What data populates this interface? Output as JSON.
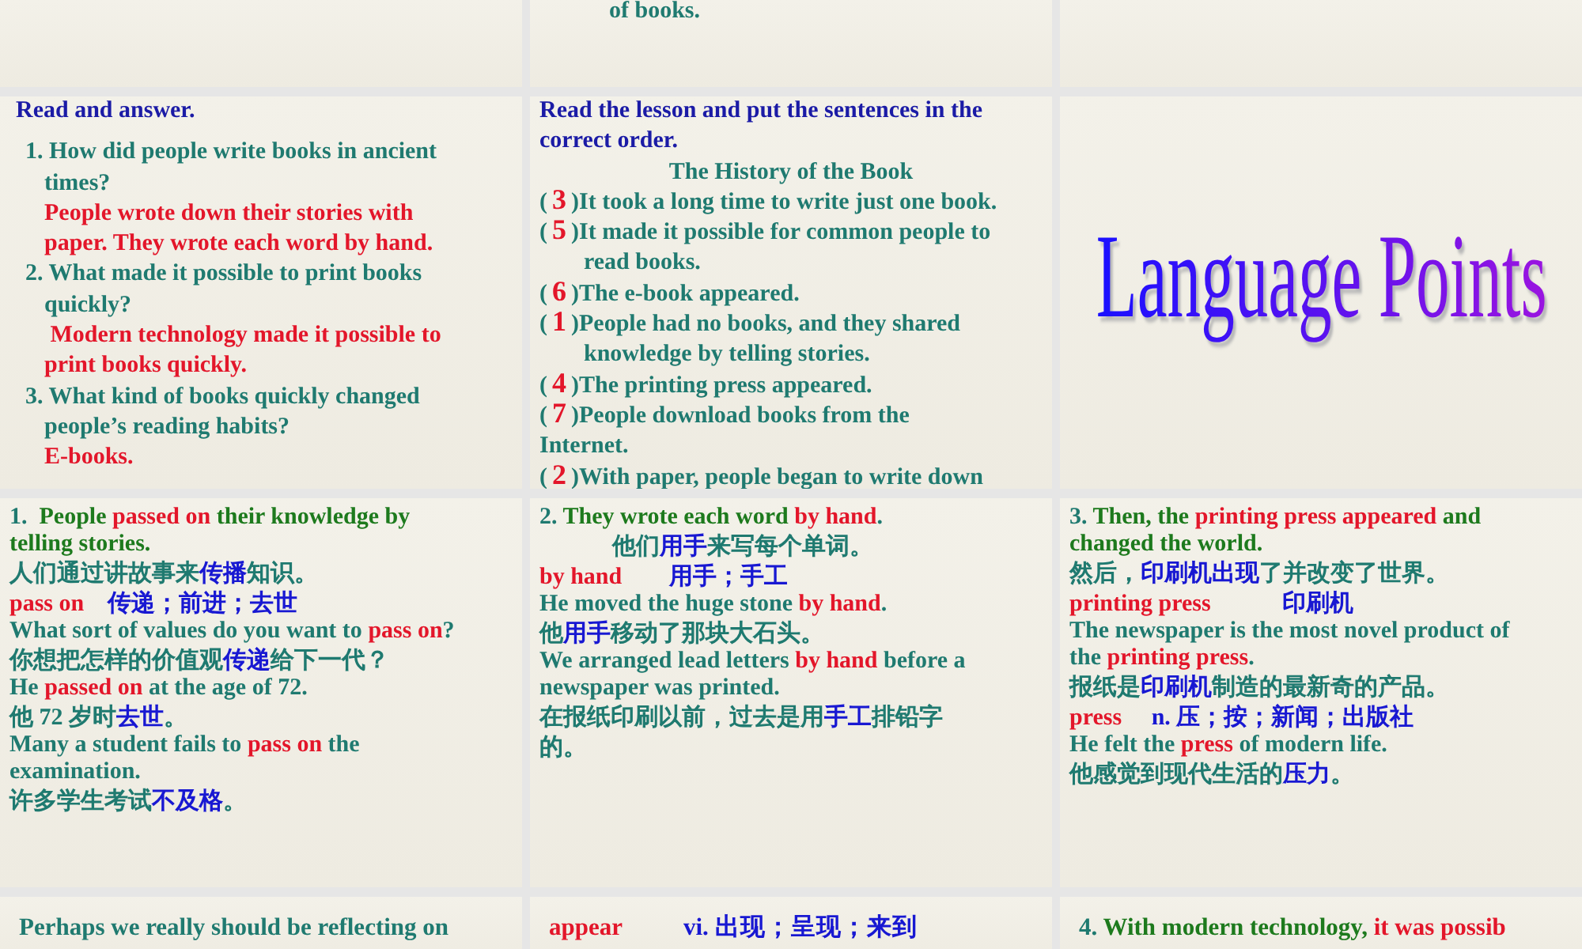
{
  "slides": [
    {
      "kind": "text"
    },
    {
      "kind": "text",
      "lines": [
        {
          "kind": "hang",
          "parts": [
            {
              "t": "of books.",
              "kind": "body"
            }
          ]
        }
      ]
    },
    {
      "kind": "text"
    },
    {
      "kind": "text",
      "lines": [
        {
          "kind": "head",
          "parts": [
            {
              "t": "Read and answer.",
              "kind": "heading"
            }
          ]
        },
        {
          "kind": "item",
          "parts": [
            {
              "t": "1. How did people write books in ancient",
              "kind": "body"
            }
          ]
        },
        {
          "kind": "cont",
          "parts": [
            {
              "t": "times?",
              "kind": "body"
            }
          ]
        },
        {
          "kind": "cont",
          "parts": [
            {
              "t": "People wrote down their stories with",
              "kind": "term"
            }
          ]
        },
        {
          "kind": "cont",
          "parts": [
            {
              "t": "paper. They wrote each word by hand.",
              "kind": "term"
            }
          ]
        },
        {
          "kind": "item",
          "parts": [
            {
              "t": "2. What made it possible to print books",
              "kind": "body"
            }
          ]
        },
        {
          "kind": "cont",
          "parts": [
            {
              "t": "quickly?",
              "kind": "body"
            }
          ]
        },
        {
          "kind": "cont",
          "parts": [
            {
              "t": " Modern technology made it possible to",
              "kind": "term"
            }
          ]
        },
        {
          "kind": "cont",
          "parts": [
            {
              "t": "print books quickly.",
              "kind": "term"
            }
          ]
        },
        {
          "kind": "item",
          "parts": [
            {
              "t": "3. What kind of books quickly changed",
              "kind": "body"
            }
          ]
        },
        {
          "kind": "cont",
          "parts": [
            {
              "t": "people’s reading habits?",
              "kind": "body"
            }
          ]
        },
        {
          "kind": "cont",
          "parts": [
            {
              "t": "E-books.",
              "kind": "term"
            }
          ]
        }
      ]
    },
    {
      "kind": "text",
      "lines": [
        {
          "kind": "flush",
          "parts": [
            {
              "t": "Read the lesson and put the sentences in the",
              "kind": "heading"
            }
          ]
        },
        {
          "kind": "flush",
          "parts": [
            {
              "t": "correct order.",
              "kind": "heading"
            }
          ]
        },
        {
          "kind": "center",
          "parts": [
            {
              "t": "The History of the Book",
              "kind": "body"
            }
          ]
        },
        {
          "kind": "flush",
          "parts": [
            {
              "t": "(",
              "kind": "body"
            },
            {
              "t": "3",
              "kind": "answer"
            },
            {
              "t": ")It took a long time to write just one book.",
              "kind": "body"
            }
          ]
        },
        {
          "kind": "flush",
          "parts": [
            {
              "t": "(",
              "kind": "body"
            },
            {
              "t": "5",
              "kind": "answer"
            },
            {
              "t": ")It made it possible for common people to",
              "kind": "body"
            }
          ]
        },
        {
          "kind": "hang",
          "parts": [
            {
              "t": "read books.",
              "kind": "body"
            }
          ]
        },
        {
          "kind": "flush",
          "parts": [
            {
              "t": "(",
              "kind": "body"
            },
            {
              "t": "6",
              "kind": "answer"
            },
            {
              "t": ")The e-book appeared.",
              "kind": "body"
            }
          ]
        },
        {
          "kind": "flush",
          "parts": [
            {
              "t": "(",
              "kind": "body"
            },
            {
              "t": "1",
              "kind": "answer"
            },
            {
              "t": ")People had no books, and they shared",
              "kind": "body"
            }
          ]
        },
        {
          "kind": "hang",
          "parts": [
            {
              "t": "knowledge by telling stories.",
              "kind": "body"
            }
          ]
        },
        {
          "kind": "flush",
          "parts": [
            {
              "t": "(",
              "kind": "body"
            },
            {
              "t": "4",
              "kind": "answer"
            },
            {
              "t": ")The printing press appeared.",
              "kind": "body"
            }
          ]
        },
        {
          "kind": "flush",
          "parts": [
            {
              "t": "(",
              "kind": "body"
            },
            {
              "t": "7",
              "kind": "answer"
            },
            {
              "t": ")People download books from the",
              "kind": "body"
            }
          ]
        },
        {
          "kind": "flush",
          "parts": [
            {
              "t": "Internet.",
              "kind": "body"
            }
          ]
        },
        {
          "kind": "flush",
          "parts": [
            {
              "t": "(",
              "kind": "body"
            },
            {
              "t": "2",
              "kind": "answer"
            },
            {
              "t": ")With paper, people began to write down",
              "kind": "body"
            }
          ]
        }
      ]
    },
    {
      "kind": "title",
      "title": "Language Points"
    },
    {
      "kind": "text",
      "lines": [
        {
          "kind": "flush",
          "parts": [
            {
              "t": "1.  ",
              "kind": "body"
            },
            {
              "t": "People ",
              "kind": "lead"
            },
            {
              "t": "passed on",
              "kind": "term"
            },
            {
              "t": " their knowledge by",
              "kind": "lead"
            }
          ]
        },
        {
          "kind": "flush",
          "parts": [
            {
              "t": "telling stories.",
              "kind": "lead"
            }
          ]
        },
        {
          "kind": "flush",
          "parts": [
            {
              "t": "人们通过讲故事来",
              "kind": "body"
            },
            {
              "t": "传播",
              "kind": "gloss"
            },
            {
              "t": "知识。",
              "kind": "body"
            }
          ]
        },
        {
          "kind": "flush",
          "parts": [
            {
              "t": "pass on",
              "kind": "term"
            },
            {
              "t": "    传递；前进；去世",
              "kind": "gloss"
            }
          ]
        },
        {
          "kind": "flush",
          "parts": [
            {
              "t": "What sort of values do you want to ",
              "kind": "body"
            },
            {
              "t": "pass on",
              "kind": "term"
            },
            {
              "t": "?",
              "kind": "body"
            }
          ]
        },
        {
          "kind": "flush",
          "parts": [
            {
              "t": "你想把怎样的价值观",
              "kind": "body"
            },
            {
              "t": "传递",
              "kind": "gloss"
            },
            {
              "t": "给下一代？",
              "kind": "body"
            }
          ]
        },
        {
          "kind": "flush",
          "parts": [
            {
              "t": "He ",
              "kind": "body"
            },
            {
              "t": "passed on",
              "kind": "term"
            },
            {
              "t": " at the age of 72.",
              "kind": "body"
            }
          ]
        },
        {
          "kind": "flush",
          "parts": [
            {
              "t": "他 72 岁时",
              "kind": "body"
            },
            {
              "t": "去世",
              "kind": "gloss"
            },
            {
              "t": "。",
              "kind": "body"
            }
          ]
        },
        {
          "kind": "flush",
          "parts": [
            {
              "t": "Many a student fails to ",
              "kind": "body"
            },
            {
              "t": "pass on",
              "kind": "term"
            },
            {
              "t": " the",
              "kind": "body"
            }
          ]
        },
        {
          "kind": "flush",
          "parts": [
            {
              "t": "examination.",
              "kind": "body"
            }
          ]
        },
        {
          "kind": "flush",
          "parts": [
            {
              "t": "许多学生考试",
              "kind": "body"
            },
            {
              "t": "不及格",
              "kind": "gloss"
            },
            {
              "t": "。",
              "kind": "body"
            }
          ]
        }
      ]
    },
    {
      "kind": "text",
      "lines": [
        {
          "kind": "flush",
          "parts": [
            {
              "t": "2. ",
              "kind": "body"
            },
            {
              "t": "They wrote each word ",
              "kind": "lead"
            },
            {
              "t": "by hand",
              "kind": "term"
            },
            {
              "t": ".",
              "kind": "body"
            }
          ]
        },
        {
          "kind": "indent",
          "parts": [
            {
              "t": "他们",
              "kind": "body"
            },
            {
              "t": "用手",
              "kind": "gloss"
            },
            {
              "t": "来写每个单词。",
              "kind": "body"
            }
          ]
        },
        {
          "kind": "flush",
          "parts": [
            {
              "t": "by hand",
              "kind": "term"
            },
            {
              "t": "        用手；手工",
              "kind": "gloss"
            }
          ]
        },
        {
          "kind": "flush",
          "parts": [
            {
              "t": "He moved the huge stone ",
              "kind": "body"
            },
            {
              "t": "by hand",
              "kind": "term"
            },
            {
              "t": ".",
              "kind": "body"
            }
          ]
        },
        {
          "kind": "flush",
          "parts": [
            {
              "t": "他",
              "kind": "body"
            },
            {
              "t": "用手",
              "kind": "gloss"
            },
            {
              "t": "移动了那块大石头。",
              "kind": "body"
            }
          ]
        },
        {
          "kind": "flush",
          "parts": [
            {
              "t": "We arranged lead letters ",
              "kind": "body"
            },
            {
              "t": "by hand",
              "kind": "term"
            },
            {
              "t": " before a",
              "kind": "body"
            }
          ]
        },
        {
          "kind": "flush",
          "parts": [
            {
              "t": "newspaper was printed.",
              "kind": "body"
            }
          ]
        },
        {
          "kind": "flush",
          "parts": [
            {
              "t": "在报纸印刷以前，过去是用",
              "kind": "body"
            },
            {
              "t": "手工",
              "kind": "gloss"
            },
            {
              "t": "排铅字",
              "kind": "body"
            }
          ]
        },
        {
          "kind": "flush",
          "parts": [
            {
              "t": "的。",
              "kind": "body"
            }
          ]
        }
      ]
    },
    {
      "kind": "text",
      "lines": [
        {
          "kind": "flush",
          "parts": [
            {
              "t": "3. ",
              "kind": "body"
            },
            {
              "t": "Then, the ",
              "kind": "lead"
            },
            {
              "t": "printing press appeared",
              "kind": "term"
            },
            {
              "t": " and",
              "kind": "lead"
            }
          ]
        },
        {
          "kind": "flush",
          "parts": [
            {
              "t": "changed the world.",
              "kind": "lead"
            }
          ]
        },
        {
          "kind": "flush",
          "parts": [
            {
              "t": "然后，",
              "kind": "body"
            },
            {
              "t": "印刷机出现",
              "kind": "gloss"
            },
            {
              "t": "了并改变了世界。",
              "kind": "body"
            }
          ]
        },
        {
          "kind": "flush",
          "parts": [
            {
              "t": "printing press",
              "kind": "term"
            },
            {
              "t": "            印刷机",
              "kind": "gloss"
            }
          ]
        },
        {
          "kind": "flush",
          "parts": [
            {
              "t": "The newspaper is the most novel product of",
              "kind": "body"
            }
          ]
        },
        {
          "kind": "flush",
          "parts": [
            {
              "t": "the ",
              "kind": "body"
            },
            {
              "t": "printing press",
              "kind": "term"
            },
            {
              "t": ".",
              "kind": "body"
            }
          ]
        },
        {
          "kind": "flush",
          "parts": [
            {
              "t": "报纸是",
              "kind": "body"
            },
            {
              "t": "印刷机",
              "kind": "gloss"
            },
            {
              "t": "制造的最新奇的产品。",
              "kind": "body"
            }
          ]
        },
        {
          "kind": "flush",
          "parts": [
            {
              "t": "press",
              "kind": "term"
            },
            {
              "t": "     n. 压；按；新闻；出版社",
              "kind": "gloss"
            }
          ]
        },
        {
          "kind": "flush",
          "parts": [
            {
              "t": "He felt the ",
              "kind": "body"
            },
            {
              "t": "press",
              "kind": "term"
            },
            {
              "t": " of modern life.",
              "kind": "body"
            }
          ]
        },
        {
          "kind": "flush",
          "parts": [
            {
              "t": "他感觉到现代生活的",
              "kind": "body"
            },
            {
              "t": "压力",
              "kind": "gloss"
            },
            {
              "t": "。",
              "kind": "body"
            }
          ]
        }
      ]
    },
    {
      "kind": "text",
      "lines": [
        {
          "kind": "flush",
          "parts": [
            {
              "t": "Perhaps we really should be reflecting on",
              "kind": "body"
            }
          ]
        }
      ]
    },
    {
      "kind": "text",
      "lines": [
        {
          "kind": "flush",
          "parts": [
            {
              "t": "appear",
              "kind": "term"
            },
            {
              "t": "          vi. 出现；呈现；来到",
              "kind": "gloss"
            }
          ]
        }
      ]
    },
    {
      "kind": "text",
      "lines": [
        {
          "kind": "flush",
          "parts": [
            {
              "t": "4. ",
              "kind": "body"
            },
            {
              "t": "With modern technology, ",
              "kind": "lead"
            },
            {
              "t": "it was possib",
              "kind": "term"
            }
          ]
        }
      ]
    }
  ]
}
